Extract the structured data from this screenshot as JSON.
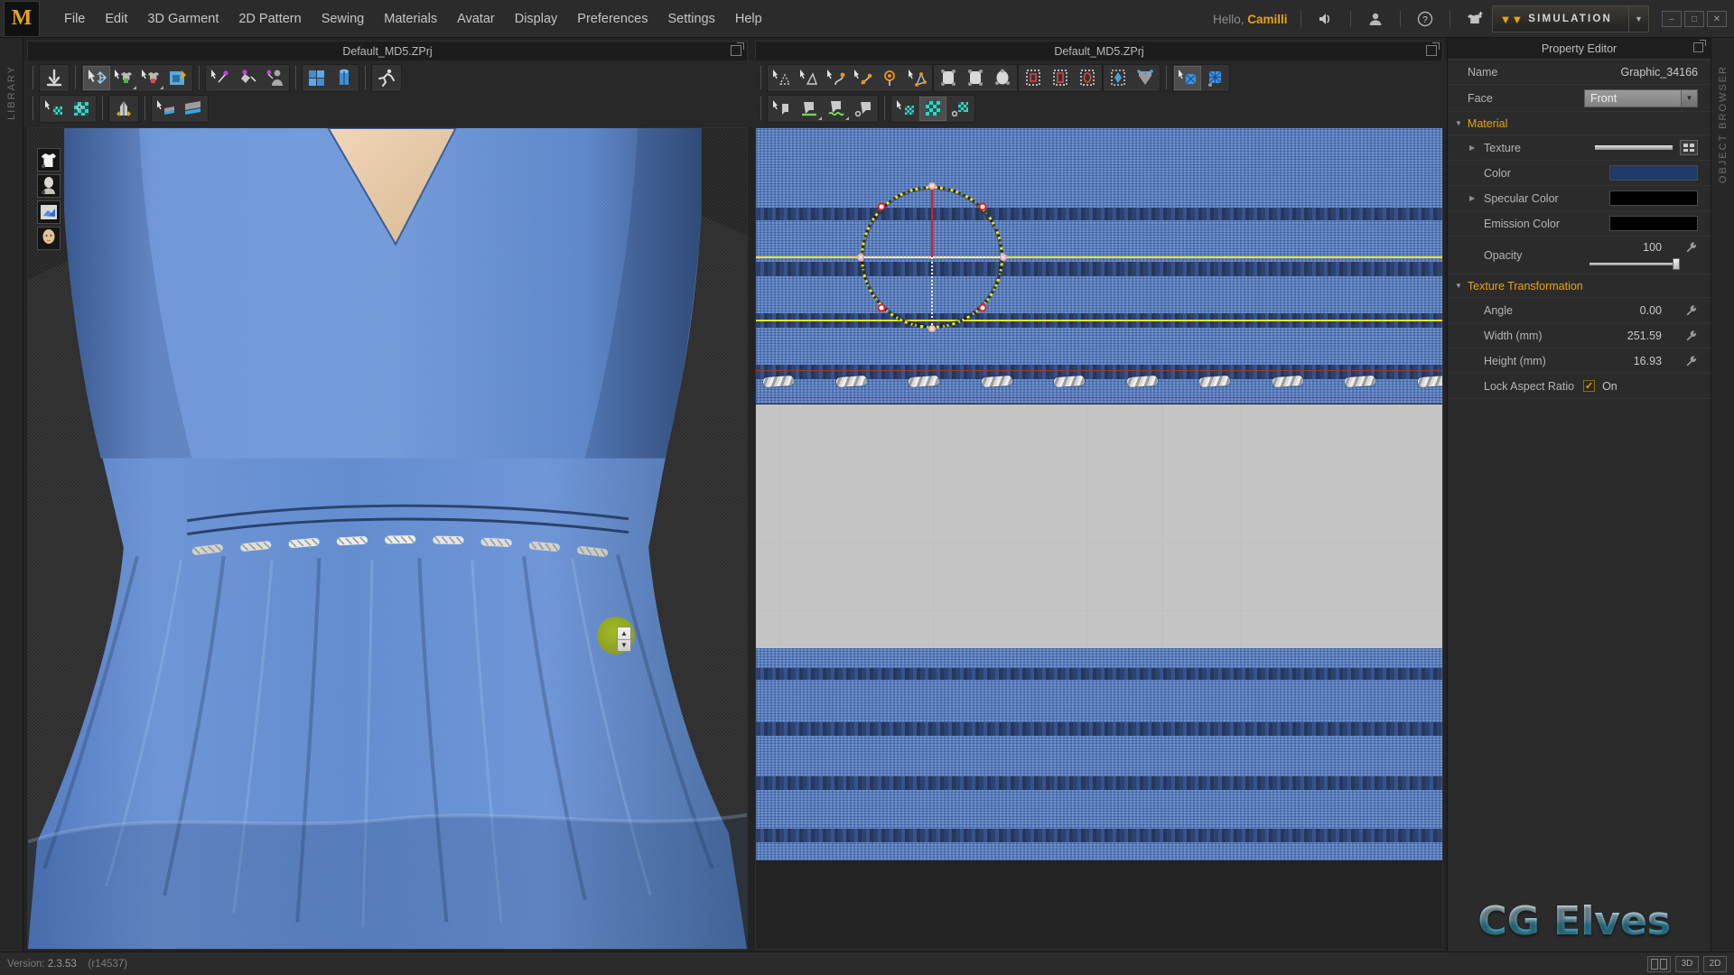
{
  "app": {
    "title": "Default_MD5.ZPrj",
    "logo_letter": "M"
  },
  "menubar": {
    "items": [
      {
        "label": "File"
      },
      {
        "label": "Edit"
      },
      {
        "label": "3D Garment"
      },
      {
        "label": "2D Pattern"
      },
      {
        "label": "Sewing"
      },
      {
        "label": "Materials"
      },
      {
        "label": "Avatar"
      },
      {
        "label": "Display"
      },
      {
        "label": "Preferences"
      },
      {
        "label": "Settings"
      },
      {
        "label": "Help"
      }
    ],
    "greeting": "Hello,",
    "username": "Camilli",
    "icons": [
      {
        "name": "speaker-icon"
      },
      {
        "name": "user-account-icon"
      },
      {
        "name": "help-icon"
      },
      {
        "name": "add-garment-icon"
      }
    ],
    "simulation_button": {
      "label": "SIMULATION",
      "chevron": "»"
    },
    "window_controls": [
      {
        "name": "minimize-button",
        "glyph": "–"
      },
      {
        "name": "maximize-button",
        "glyph": "□"
      },
      {
        "name": "close-button",
        "glyph": "✕"
      }
    ]
  },
  "sidetabs": {
    "left": "LIBRARY",
    "right": "OBJECT BROWSER"
  },
  "view3d": {
    "panel_title": "Default_MD5.ZPrj",
    "toolbar_row1": [
      {
        "name": "import-arrow-tool"
      },
      {
        "name": "transform-garment-tool",
        "active": true
      },
      {
        "name": "select-mesh-tool"
      },
      {
        "name": "select-mesh-box-tool"
      },
      {
        "name": "unfold-arrange-tool"
      },
      {
        "name": "pin-select-tool"
      },
      {
        "name": "pin-place-tool"
      },
      {
        "name": "avatar-pin-tool"
      },
      {
        "name": "gizmo-fold-tool"
      },
      {
        "name": "gizmo-garment-tool"
      },
      {
        "name": "animation-run-tool"
      }
    ],
    "toolbar_row2": [
      {
        "name": "select-texture-tool"
      },
      {
        "name": "place-texture-tool"
      },
      {
        "name": "zipper-tool"
      },
      {
        "name": "select-panel-tool"
      },
      {
        "name": "fold-panel-tool"
      }
    ],
    "thumbnails": [
      {
        "name": "garment-thumbnail"
      },
      {
        "name": "avatar-head-thumbnail"
      },
      {
        "name": "fabric-swatch-thumbnail"
      },
      {
        "name": "avatar-face-thumbnail"
      }
    ]
  },
  "view2d": {
    "panel_title": "Default_MD5.ZPrj",
    "toolbar_row1": [
      {
        "name": "edit-pattern-tool"
      },
      {
        "name": "edit-curvature-tool"
      },
      {
        "name": "edit-curve-point-tool"
      },
      {
        "name": "add-point-split-tool"
      },
      {
        "name": "rotate-point-tool"
      },
      {
        "name": "polygon-tool"
      },
      {
        "name": "rectangle-pattern-tool"
      },
      {
        "name": "circle-pattern-tool"
      },
      {
        "name": "ellipse-pattern-tool"
      },
      {
        "name": "inner-rectangle-tool"
      },
      {
        "name": "inner-polygon-tool"
      },
      {
        "name": "inner-circle-tool"
      },
      {
        "name": "dart-tool"
      },
      {
        "name": "pleat-tool"
      },
      {
        "name": "select-graphic-tool",
        "active": true
      },
      {
        "name": "transform-graphic-tool"
      }
    ],
    "toolbar_row2": [
      {
        "name": "select-sewing-tool"
      },
      {
        "name": "segment-sewing-tool"
      },
      {
        "name": "free-sewing-tool"
      },
      {
        "name": "edit-sewing-tool"
      },
      {
        "name": "select-texture-2d-tool"
      },
      {
        "name": "edit-texture-2d-tool",
        "active": true
      },
      {
        "name": "adjust-texture-2d-tool"
      }
    ]
  },
  "property_editor": {
    "title": "Property Editor",
    "rows": [
      {
        "key": "Name",
        "value": "Graphic_34166",
        "type": "text"
      },
      {
        "key": "Face",
        "value": "Front",
        "type": "combo"
      }
    ],
    "material_section": {
      "label": "Material",
      "rows": [
        {
          "key": "Texture",
          "type": "texture",
          "has_tri": true
        },
        {
          "key": "Color",
          "type": "swatch",
          "color": "#1f3a66"
        },
        {
          "key": "Specular Color",
          "type": "swatch",
          "color": "#000000",
          "has_tri": true
        },
        {
          "key": "Emission Color",
          "type": "swatch",
          "color": "#000000"
        },
        {
          "key": "Opacity",
          "value": "100",
          "type": "slider"
        }
      ]
    },
    "texture_transformation_section": {
      "label": "Texture Transformation",
      "rows": [
        {
          "key": "Angle",
          "value": "0.00",
          "type": "value"
        },
        {
          "key": "Width (mm)",
          "value": "251.59",
          "type": "value"
        },
        {
          "key": "Height (mm)",
          "value": "16.93",
          "type": "value"
        },
        {
          "key": "Lock Aspect Ratio",
          "value": "On",
          "type": "checkbox",
          "checked": true
        }
      ]
    },
    "accent_color": "#e8a317"
  },
  "statusbar": {
    "version_label": "Version:",
    "version": "2.3.53",
    "revision": "(r14537)",
    "view_buttons": [
      {
        "name": "split-view-button",
        "label": ""
      },
      {
        "name": "view-3d-button",
        "label": "3D"
      },
      {
        "name": "view-2d-button",
        "label": "2D"
      }
    ]
  },
  "watermark": {
    "text": "CG Elves"
  }
}
